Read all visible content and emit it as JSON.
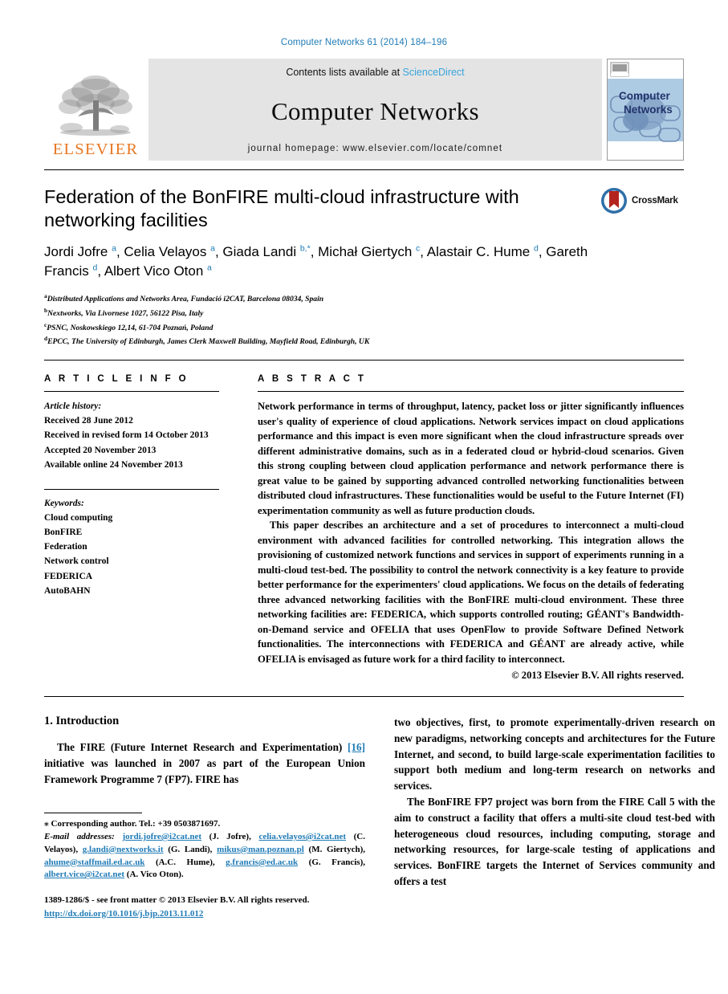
{
  "running_head": "Computer Networks 61 (2014) 184–196",
  "masthead": {
    "publisher_name": "ELSEVIER",
    "contents_prefix": "Contents lists available at ",
    "contents_link": "ScienceDirect",
    "journal_name": "Computer Networks",
    "homepage_line": "journal homepage: www.elsevier.com/locate/comnet",
    "cover_title_line1": "Computer",
    "cover_title_line2": "Networks"
  },
  "article": {
    "title": "Federation of the BonFIRE multi-cloud infrastructure with networking facilities",
    "crossmark_label": "CrossMark",
    "authors_html": "Jordi Jofre <sup>a</sup>, Celia Velayos <sup>a</sup>, Giada Landi <sup>b,</sup><sup class=\"star\">*</sup>, Michał Giertych <sup>c</sup>, Alastair C. Hume <sup>d</sup>, Gareth Francis <sup>d</sup>, Albert Vico Oton <sup>a</sup>",
    "affiliations": [
      {
        "marker": "a",
        "text": "Distributed Applications and Networks Area, Fundació i2CAT, Barcelona 08034, Spain"
      },
      {
        "marker": "b",
        "text": "Nextworks, Via Livornese 1027, 56122 Pisa, Italy"
      },
      {
        "marker": "c",
        "text": "PSNC, Noskowskiego 12,14, 61-704 Poznań, Poland"
      },
      {
        "marker": "d",
        "text": "EPCC, The University of Edinburgh, James Clerk Maxwell Building, Mayfield Road, Edinburgh, UK"
      }
    ]
  },
  "article_info": {
    "heading": "A R T I C L E    I N F O",
    "history_label": "Article history:",
    "history": [
      "Received 28 June 2012",
      "Received in revised form 14 October 2013",
      "Accepted 20 November 2013",
      "Available online 24 November 2013"
    ],
    "keywords_label": "Keywords:",
    "keywords": [
      "Cloud computing",
      "BonFIRE",
      "Federation",
      "Network control",
      "FEDERICA",
      "AutoBAHN"
    ]
  },
  "abstract": {
    "heading": "A B S T R A C T",
    "paragraphs": [
      "Network performance in terms of throughput, latency, packet loss or jitter significantly influences user's quality of experience of cloud applications. Network services impact on cloud applications performance and this impact is even more significant when the cloud infrastructure spreads over different administrative domains, such as in a federated cloud or hybrid-cloud scenarios. Given this strong coupling between cloud application performance and network performance there is great value to be gained by supporting advanced controlled networking functionalities between distributed cloud infrastructures. These functionalities would be useful to the Future Internet (FI) experimentation community as well as future production clouds.",
      "This paper describes an architecture and a set of procedures to interconnect a multi-cloud environment with advanced facilities for controlled networking. This integration allows the provisioning of customized network functions and services in support of experiments running in a multi-cloud test-bed. The possibility to control the network connectivity is a key feature to provide better performance for the experimenters' cloud applications. We focus on the details of federating three advanced networking facilities with the BonFIRE multi-cloud environment. These three networking facilities are: FEDERICA, which supports controlled routing; GÉANT's Bandwidth-on-Demand service and OFELIA that uses OpenFlow to provide Software Defined Network functionalities. The interconnections with FEDERICA and GÉANT are already active, while OFELIA is envisaged as future work for a third facility to interconnect."
    ],
    "copyright": "© 2013 Elsevier B.V. All rights reserved."
  },
  "introduction": {
    "heading": "1. Introduction",
    "left_para1_before_ref": "The FIRE (Future Internet Research and Experimentation) ",
    "left_ref": "[16]",
    "left_para1_after_ref": " initiative was launched in 2007 as part of the European Union Framework Programme 7 (FP7). FIRE has",
    "right_para1": "two objectives, first, to promote experimentally-driven research on new paradigms, networking concepts and architectures for the Future Internet, and second, to build large-scale experimentation facilities to support both medium and long-term research on networks and services.",
    "right_para2": "The BonFIRE FP7 project was born from the FIRE Call 5 with the aim to construct a facility that offers a multi-site cloud test-bed with heterogeneous cloud resources, including computing, storage and networking resources, for large-scale testing of applications and services. BonFIRE targets the Internet of Services community and offers a test"
  },
  "footnote": {
    "corresponding": "⁎ Corresponding author. Tel.: +39 0503871697.",
    "email_label": "E-mail addresses:",
    "emails": [
      {
        "address": "jordi.jofre@i2cat.net",
        "name": "(J. Jofre),"
      },
      {
        "address": "celia.velayos@i2cat.net",
        "name": "(C. Velayos),"
      },
      {
        "address": "g.landi@nextworks.it",
        "name": "(G. Landi),"
      },
      {
        "address": "mikus@man.poznan.pl",
        "name": "(M. Giertych),"
      },
      {
        "address": "ahume@staffmail.ed.ac.uk",
        "name": "(A.C. Hume),"
      },
      {
        "address": "g.francis@ed.ac.uk",
        "name": "(G. Francis),"
      },
      {
        "address": "albert.vico@i2cat.net",
        "name": "(A. Vico Oton)."
      }
    ]
  },
  "bottom_matter": {
    "issn_line": "1389-1286/$ - see front matter © 2013 Elsevier B.V. All rights reserved.",
    "doi": "http://dx.doi.org/10.1016/j.bjp.2013.11.012"
  },
  "colors": {
    "link_blue": "#1f7bb6",
    "sciencedirect_blue": "#3aa5dc",
    "elsevier_orange": "#e87722",
    "band_grey": "#e4e4e4",
    "cover_blue": "#aecbe4"
  }
}
